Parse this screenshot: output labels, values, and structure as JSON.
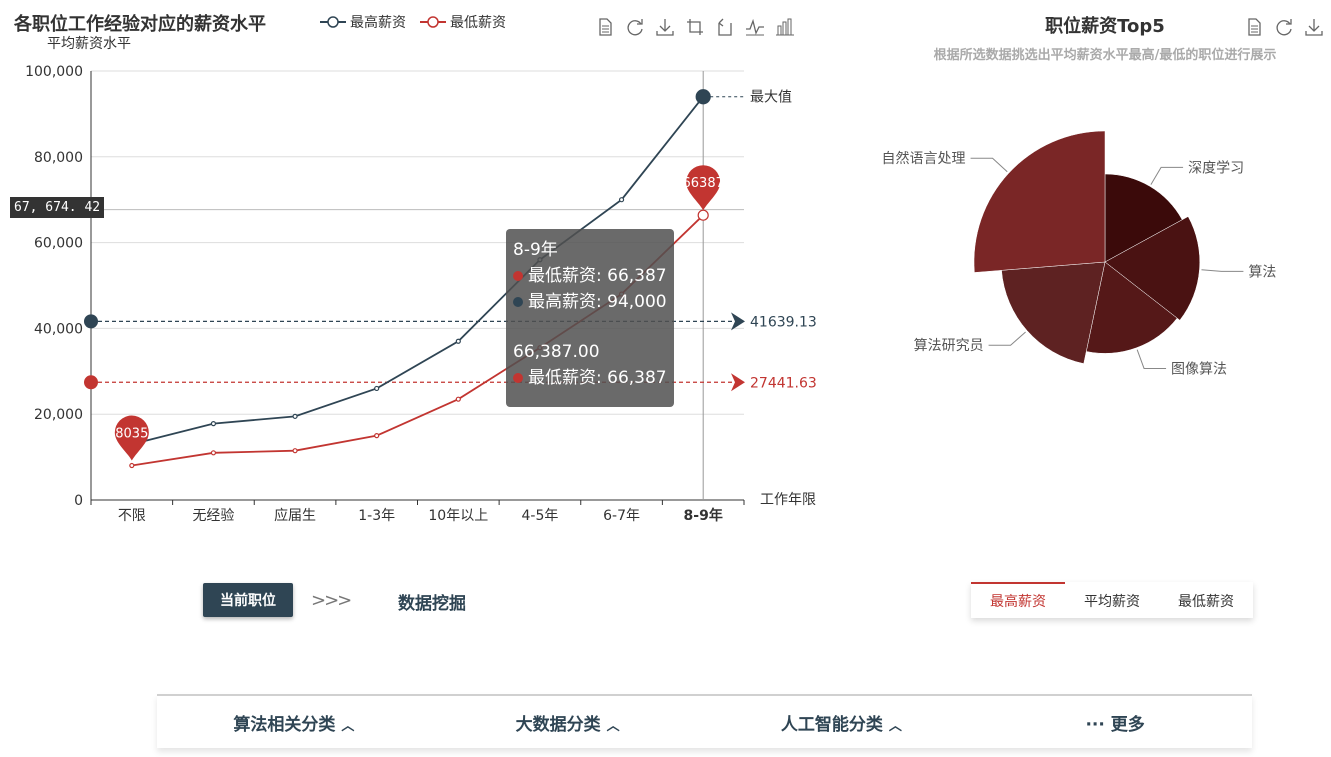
{
  "line_chart": {
    "title": "各职位工作经验对应的薪资水平",
    "ylabel": "平均薪资水平",
    "xlabel": "工作年限",
    "legend": [
      "最高薪资",
      "最低薪资"
    ],
    "axis_pointer_value": "67, 674. 42",
    "max_label": "最大值",
    "toolbox": [
      "data-view-icon",
      "restore-icon",
      "save-image-icon",
      "zoom-icon",
      "zoom-reset-icon",
      "line-type-icon",
      "bar-type-icon"
    ]
  },
  "chart_data": [
    {
      "type": "line",
      "categories": [
        "不限",
        "无经验",
        "应届生",
        "1-3年",
        "10年以上",
        "4-5年",
        "6-7年",
        "8-9年"
      ],
      "series": [
        {
          "name": "最高薪资",
          "color": "#2f4554",
          "values": [
            13000,
            17800,
            19500,
            26000,
            37000,
            56000,
            70000,
            94000
          ],
          "avg": 41639.13
        },
        {
          "name": "最低薪资",
          "color": "#c23531",
          "values": [
            8035,
            11000,
            11500,
            15000,
            23500,
            35500,
            48000,
            66387
          ],
          "avg": 27441.63,
          "min_label": "8035",
          "max_label": "66387"
        }
      ],
      "ylim": [
        0,
        100000
      ],
      "yticks": [
        "0",
        "20,000",
        "40,000",
        "60,000",
        "80,000",
        "100,000"
      ],
      "avg_labels": [
        "41639.13",
        "27441.63"
      ],
      "ylabel": "平均薪资水平",
      "xlabel": "工作年限"
    },
    {
      "type": "pie",
      "title": "职位薪资Top5",
      "subtitle": "根据所选数据挑选出平均薪资水平最高/最低的职位进行展示",
      "rose": true,
      "slices": [
        {
          "name": "深度学习",
          "value": 35000,
          "color": "#3b0a0a"
        },
        {
          "name": "算法",
          "value": 38000,
          "color": "#4a1212"
        },
        {
          "name": "图像算法",
          "value": 36500,
          "color": "#551818"
        },
        {
          "name": "算法研究员",
          "value": 42000,
          "color": "#5e2222"
        },
        {
          "name": "自然语言处理",
          "value": 54000,
          "color": "#7a2626"
        }
      ]
    }
  ],
  "tooltip": {
    "category": "8-9年",
    "row1": "最低薪资: 66,387",
    "row2": "最高薪资: 94,000",
    "value": "66,387.00",
    "row3": "最低薪资: 66,387"
  },
  "pie_chart": {
    "title": "职位薪资Top5",
    "subtitle": "根据所选数据挑选出平均薪资水平最高/最低的职位进行展示",
    "toolbox": [
      "data-view-icon",
      "restore-icon",
      "save-image-icon"
    ]
  },
  "controls": {
    "current_job_label": "当前职位",
    "arrows": ">>>",
    "job_name": "数据挖掘",
    "salary_tabs": [
      "最高薪资",
      "平均薪资",
      "最低薪资"
    ],
    "active_tab": 0
  },
  "categories_bar": {
    "items": [
      "算法相关分类",
      "大数据分类",
      "人工智能分类",
      "··· 更多"
    ]
  },
  "colors": {
    "high": "#2f4554",
    "low": "#c23531"
  }
}
